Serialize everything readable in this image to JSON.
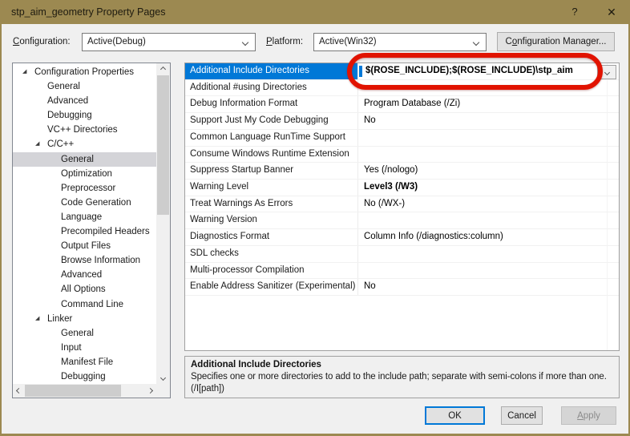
{
  "window": {
    "title": "stp_aim_geometry Property Pages",
    "help_glyph": "?",
    "close_glyph": "✕"
  },
  "toolbar": {
    "configuration_label": {
      "text": "Configuration:",
      "accel": 0
    },
    "configuration_value": "Active(Debug)",
    "platform_label": {
      "text": "Platform:",
      "accel": 0
    },
    "platform_value": "Active(Win32)",
    "config_manager_label": {
      "text": "Configuration Manager...",
      "accel": 1
    }
  },
  "tree": {
    "items": [
      {
        "label": "Configuration Properties",
        "level": 0,
        "expanded": true
      },
      {
        "label": "General",
        "level": 1
      },
      {
        "label": "Advanced",
        "level": 1
      },
      {
        "label": "Debugging",
        "level": 1
      },
      {
        "label": "VC++ Directories",
        "level": 1
      },
      {
        "label": "C/C++",
        "level": 1,
        "expanded": true
      },
      {
        "label": "General",
        "level": 2,
        "selected": true
      },
      {
        "label": "Optimization",
        "level": 2
      },
      {
        "label": "Preprocessor",
        "level": 2
      },
      {
        "label": "Code Generation",
        "level": 2
      },
      {
        "label": "Language",
        "level": 2
      },
      {
        "label": "Precompiled Headers",
        "level": 2
      },
      {
        "label": "Output Files",
        "level": 2
      },
      {
        "label": "Browse Information",
        "level": 2
      },
      {
        "label": "Advanced",
        "level": 2
      },
      {
        "label": "All Options",
        "level": 2
      },
      {
        "label": "Command Line",
        "level": 2
      },
      {
        "label": "Linker",
        "level": 1,
        "expanded": true
      },
      {
        "label": "General",
        "level": 2
      },
      {
        "label": "Input",
        "level": 2
      },
      {
        "label": "Manifest File",
        "level": 2
      },
      {
        "label": "Debugging",
        "level": 2
      }
    ]
  },
  "grid": {
    "rows": [
      {
        "name": "Additional Include Directories",
        "value": "$(ROSE_INCLUDE);$(ROSE_INCLUDE)\\stp_aim",
        "selected": true,
        "bold": true,
        "has_dropdown": true,
        "annotated": true
      },
      {
        "name": "Additional #using Directories",
        "value": ""
      },
      {
        "name": "Debug Information Format",
        "value": "Program Database (/Zi)"
      },
      {
        "name": "Support Just My Code Debugging",
        "value": "No"
      },
      {
        "name": "Common Language RunTime Support",
        "value": ""
      },
      {
        "name": "Consume Windows Runtime Extension",
        "value": ""
      },
      {
        "name": "Suppress Startup Banner",
        "value": "Yes (/nologo)"
      },
      {
        "name": "Warning Level",
        "value": "Level3 (/W3)",
        "bold": true
      },
      {
        "name": "Treat Warnings As Errors",
        "value": "No (/WX-)"
      },
      {
        "name": "Warning Version",
        "value": ""
      },
      {
        "name": "Diagnostics Format",
        "value": "Column Info (/diagnostics:column)"
      },
      {
        "name": "SDL checks",
        "value": ""
      },
      {
        "name": "Multi-processor Compilation",
        "value": ""
      },
      {
        "name": "Enable Address Sanitizer (Experimental)",
        "value": "No"
      }
    ]
  },
  "description": {
    "title": "Additional Include Directories",
    "line1": "Specifies one or more directories to add to the include path; separate with semi-colons if more than one.",
    "line2": "(/I[path])"
  },
  "buttons": {
    "ok": "OK",
    "cancel": "Cancel",
    "apply": {
      "text": "Apply",
      "accel": 0
    }
  },
  "icons": {
    "tree_expanded_glyph": "◢",
    "help": "question-mark",
    "close": "x-cross"
  },
  "colors": {
    "accent_gold": "#9c8951",
    "selection_blue": "#0078d7",
    "annotation_red": "#e11300",
    "tree_selection": "#d4d4d8",
    "button_face": "#e1e1e1"
  }
}
